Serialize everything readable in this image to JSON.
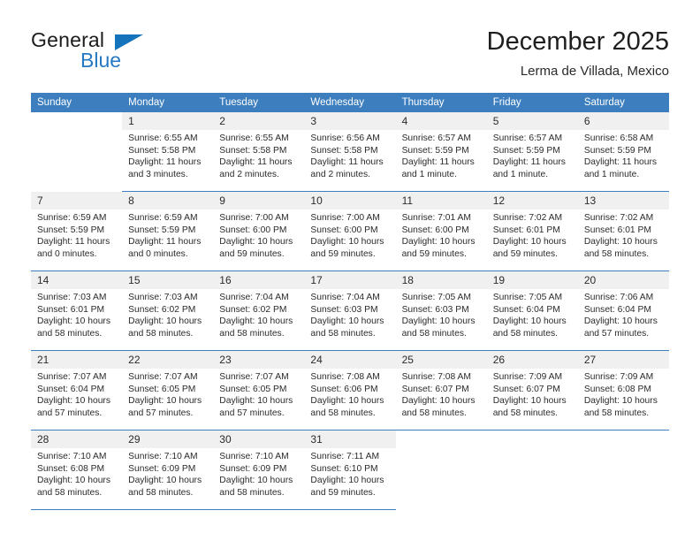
{
  "brand": {
    "word_top": "General",
    "word_bottom": "Blue",
    "accent_color": "#1573bb"
  },
  "header": {
    "month_title": "December 2025",
    "location": "Lerma de Villada, Mexico",
    "header_bg_color": "#3d7ebf",
    "daynum_bg_color": "#f0f0f0"
  },
  "weekday_headers": [
    "Sunday",
    "Monday",
    "Tuesday",
    "Wednesday",
    "Thursday",
    "Friday",
    "Saturday"
  ],
  "labels": {
    "sunrise_prefix": "Sunrise:",
    "sunset_prefix": "Sunset:",
    "daylight_prefix": "Daylight:"
  },
  "weeks": [
    [
      {
        "day": "",
        "sunrise": "",
        "sunset": "",
        "daylight_line1": "",
        "daylight_line2": "",
        "empty": true
      },
      {
        "day": "1",
        "sunrise": "Sunrise: 6:55 AM",
        "sunset": "Sunset: 5:58 PM",
        "daylight_line1": "Daylight: 11 hours",
        "daylight_line2": "and 3 minutes."
      },
      {
        "day": "2",
        "sunrise": "Sunrise: 6:55 AM",
        "sunset": "Sunset: 5:58 PM",
        "daylight_line1": "Daylight: 11 hours",
        "daylight_line2": "and 2 minutes."
      },
      {
        "day": "3",
        "sunrise": "Sunrise: 6:56 AM",
        "sunset": "Sunset: 5:58 PM",
        "daylight_line1": "Daylight: 11 hours",
        "daylight_line2": "and 2 minutes."
      },
      {
        "day": "4",
        "sunrise": "Sunrise: 6:57 AM",
        "sunset": "Sunset: 5:59 PM",
        "daylight_line1": "Daylight: 11 hours",
        "daylight_line2": "and 1 minute."
      },
      {
        "day": "5",
        "sunrise": "Sunrise: 6:57 AM",
        "sunset": "Sunset: 5:59 PM",
        "daylight_line1": "Daylight: 11 hours",
        "daylight_line2": "and 1 minute."
      },
      {
        "day": "6",
        "sunrise": "Sunrise: 6:58 AM",
        "sunset": "Sunset: 5:59 PM",
        "daylight_line1": "Daylight: 11 hours",
        "daylight_line2": "and 1 minute."
      }
    ],
    [
      {
        "day": "7",
        "sunrise": "Sunrise: 6:59 AM",
        "sunset": "Sunset: 5:59 PM",
        "daylight_line1": "Daylight: 11 hours",
        "daylight_line2": "and 0 minutes."
      },
      {
        "day": "8",
        "sunrise": "Sunrise: 6:59 AM",
        "sunset": "Sunset: 5:59 PM",
        "daylight_line1": "Daylight: 11 hours",
        "daylight_line2": "and 0 minutes."
      },
      {
        "day": "9",
        "sunrise": "Sunrise: 7:00 AM",
        "sunset": "Sunset: 6:00 PM",
        "daylight_line1": "Daylight: 10 hours",
        "daylight_line2": "and 59 minutes."
      },
      {
        "day": "10",
        "sunrise": "Sunrise: 7:00 AM",
        "sunset": "Sunset: 6:00 PM",
        "daylight_line1": "Daylight: 10 hours",
        "daylight_line2": "and 59 minutes."
      },
      {
        "day": "11",
        "sunrise": "Sunrise: 7:01 AM",
        "sunset": "Sunset: 6:00 PM",
        "daylight_line1": "Daylight: 10 hours",
        "daylight_line2": "and 59 minutes."
      },
      {
        "day": "12",
        "sunrise": "Sunrise: 7:02 AM",
        "sunset": "Sunset: 6:01 PM",
        "daylight_line1": "Daylight: 10 hours",
        "daylight_line2": "and 59 minutes."
      },
      {
        "day": "13",
        "sunrise": "Sunrise: 7:02 AM",
        "sunset": "Sunset: 6:01 PM",
        "daylight_line1": "Daylight: 10 hours",
        "daylight_line2": "and 58 minutes."
      }
    ],
    [
      {
        "day": "14",
        "sunrise": "Sunrise: 7:03 AM",
        "sunset": "Sunset: 6:01 PM",
        "daylight_line1": "Daylight: 10 hours",
        "daylight_line2": "and 58 minutes."
      },
      {
        "day": "15",
        "sunrise": "Sunrise: 7:03 AM",
        "sunset": "Sunset: 6:02 PM",
        "daylight_line1": "Daylight: 10 hours",
        "daylight_line2": "and 58 minutes."
      },
      {
        "day": "16",
        "sunrise": "Sunrise: 7:04 AM",
        "sunset": "Sunset: 6:02 PM",
        "daylight_line1": "Daylight: 10 hours",
        "daylight_line2": "and 58 minutes."
      },
      {
        "day": "17",
        "sunrise": "Sunrise: 7:04 AM",
        "sunset": "Sunset: 6:03 PM",
        "daylight_line1": "Daylight: 10 hours",
        "daylight_line2": "and 58 minutes."
      },
      {
        "day": "18",
        "sunrise": "Sunrise: 7:05 AM",
        "sunset": "Sunset: 6:03 PM",
        "daylight_line1": "Daylight: 10 hours",
        "daylight_line2": "and 58 minutes."
      },
      {
        "day": "19",
        "sunrise": "Sunrise: 7:05 AM",
        "sunset": "Sunset: 6:04 PM",
        "daylight_line1": "Daylight: 10 hours",
        "daylight_line2": "and 58 minutes."
      },
      {
        "day": "20",
        "sunrise": "Sunrise: 7:06 AM",
        "sunset": "Sunset: 6:04 PM",
        "daylight_line1": "Daylight: 10 hours",
        "daylight_line2": "and 57 minutes."
      }
    ],
    [
      {
        "day": "21",
        "sunrise": "Sunrise: 7:07 AM",
        "sunset": "Sunset: 6:04 PM",
        "daylight_line1": "Daylight: 10 hours",
        "daylight_line2": "and 57 minutes."
      },
      {
        "day": "22",
        "sunrise": "Sunrise: 7:07 AM",
        "sunset": "Sunset: 6:05 PM",
        "daylight_line1": "Daylight: 10 hours",
        "daylight_line2": "and 57 minutes."
      },
      {
        "day": "23",
        "sunrise": "Sunrise: 7:07 AM",
        "sunset": "Sunset: 6:05 PM",
        "daylight_line1": "Daylight: 10 hours",
        "daylight_line2": "and 57 minutes."
      },
      {
        "day": "24",
        "sunrise": "Sunrise: 7:08 AM",
        "sunset": "Sunset: 6:06 PM",
        "daylight_line1": "Daylight: 10 hours",
        "daylight_line2": "and 58 minutes."
      },
      {
        "day": "25",
        "sunrise": "Sunrise: 7:08 AM",
        "sunset": "Sunset: 6:07 PM",
        "daylight_line1": "Daylight: 10 hours",
        "daylight_line2": "and 58 minutes."
      },
      {
        "day": "26",
        "sunrise": "Sunrise: 7:09 AM",
        "sunset": "Sunset: 6:07 PM",
        "daylight_line1": "Daylight: 10 hours",
        "daylight_line2": "and 58 minutes."
      },
      {
        "day": "27",
        "sunrise": "Sunrise: 7:09 AM",
        "sunset": "Sunset: 6:08 PM",
        "daylight_line1": "Daylight: 10 hours",
        "daylight_line2": "and 58 minutes."
      }
    ],
    [
      {
        "day": "28",
        "sunrise": "Sunrise: 7:10 AM",
        "sunset": "Sunset: 6:08 PM",
        "daylight_line1": "Daylight: 10 hours",
        "daylight_line2": "and 58 minutes."
      },
      {
        "day": "29",
        "sunrise": "Sunrise: 7:10 AM",
        "sunset": "Sunset: 6:09 PM",
        "daylight_line1": "Daylight: 10 hours",
        "daylight_line2": "and 58 minutes."
      },
      {
        "day": "30",
        "sunrise": "Sunrise: 7:10 AM",
        "sunset": "Sunset: 6:09 PM",
        "daylight_line1": "Daylight: 10 hours",
        "daylight_line2": "and 58 minutes."
      },
      {
        "day": "31",
        "sunrise": "Sunrise: 7:11 AM",
        "sunset": "Sunset: 6:10 PM",
        "daylight_line1": "Daylight: 10 hours",
        "daylight_line2": "and 59 minutes."
      },
      {
        "day": "",
        "sunrise": "",
        "sunset": "",
        "daylight_line1": "",
        "daylight_line2": "",
        "empty": true
      },
      {
        "day": "",
        "sunrise": "",
        "sunset": "",
        "daylight_line1": "",
        "daylight_line2": "",
        "empty": true
      },
      {
        "day": "",
        "sunrise": "",
        "sunset": "",
        "daylight_line1": "",
        "daylight_line2": "",
        "empty": true
      }
    ]
  ]
}
